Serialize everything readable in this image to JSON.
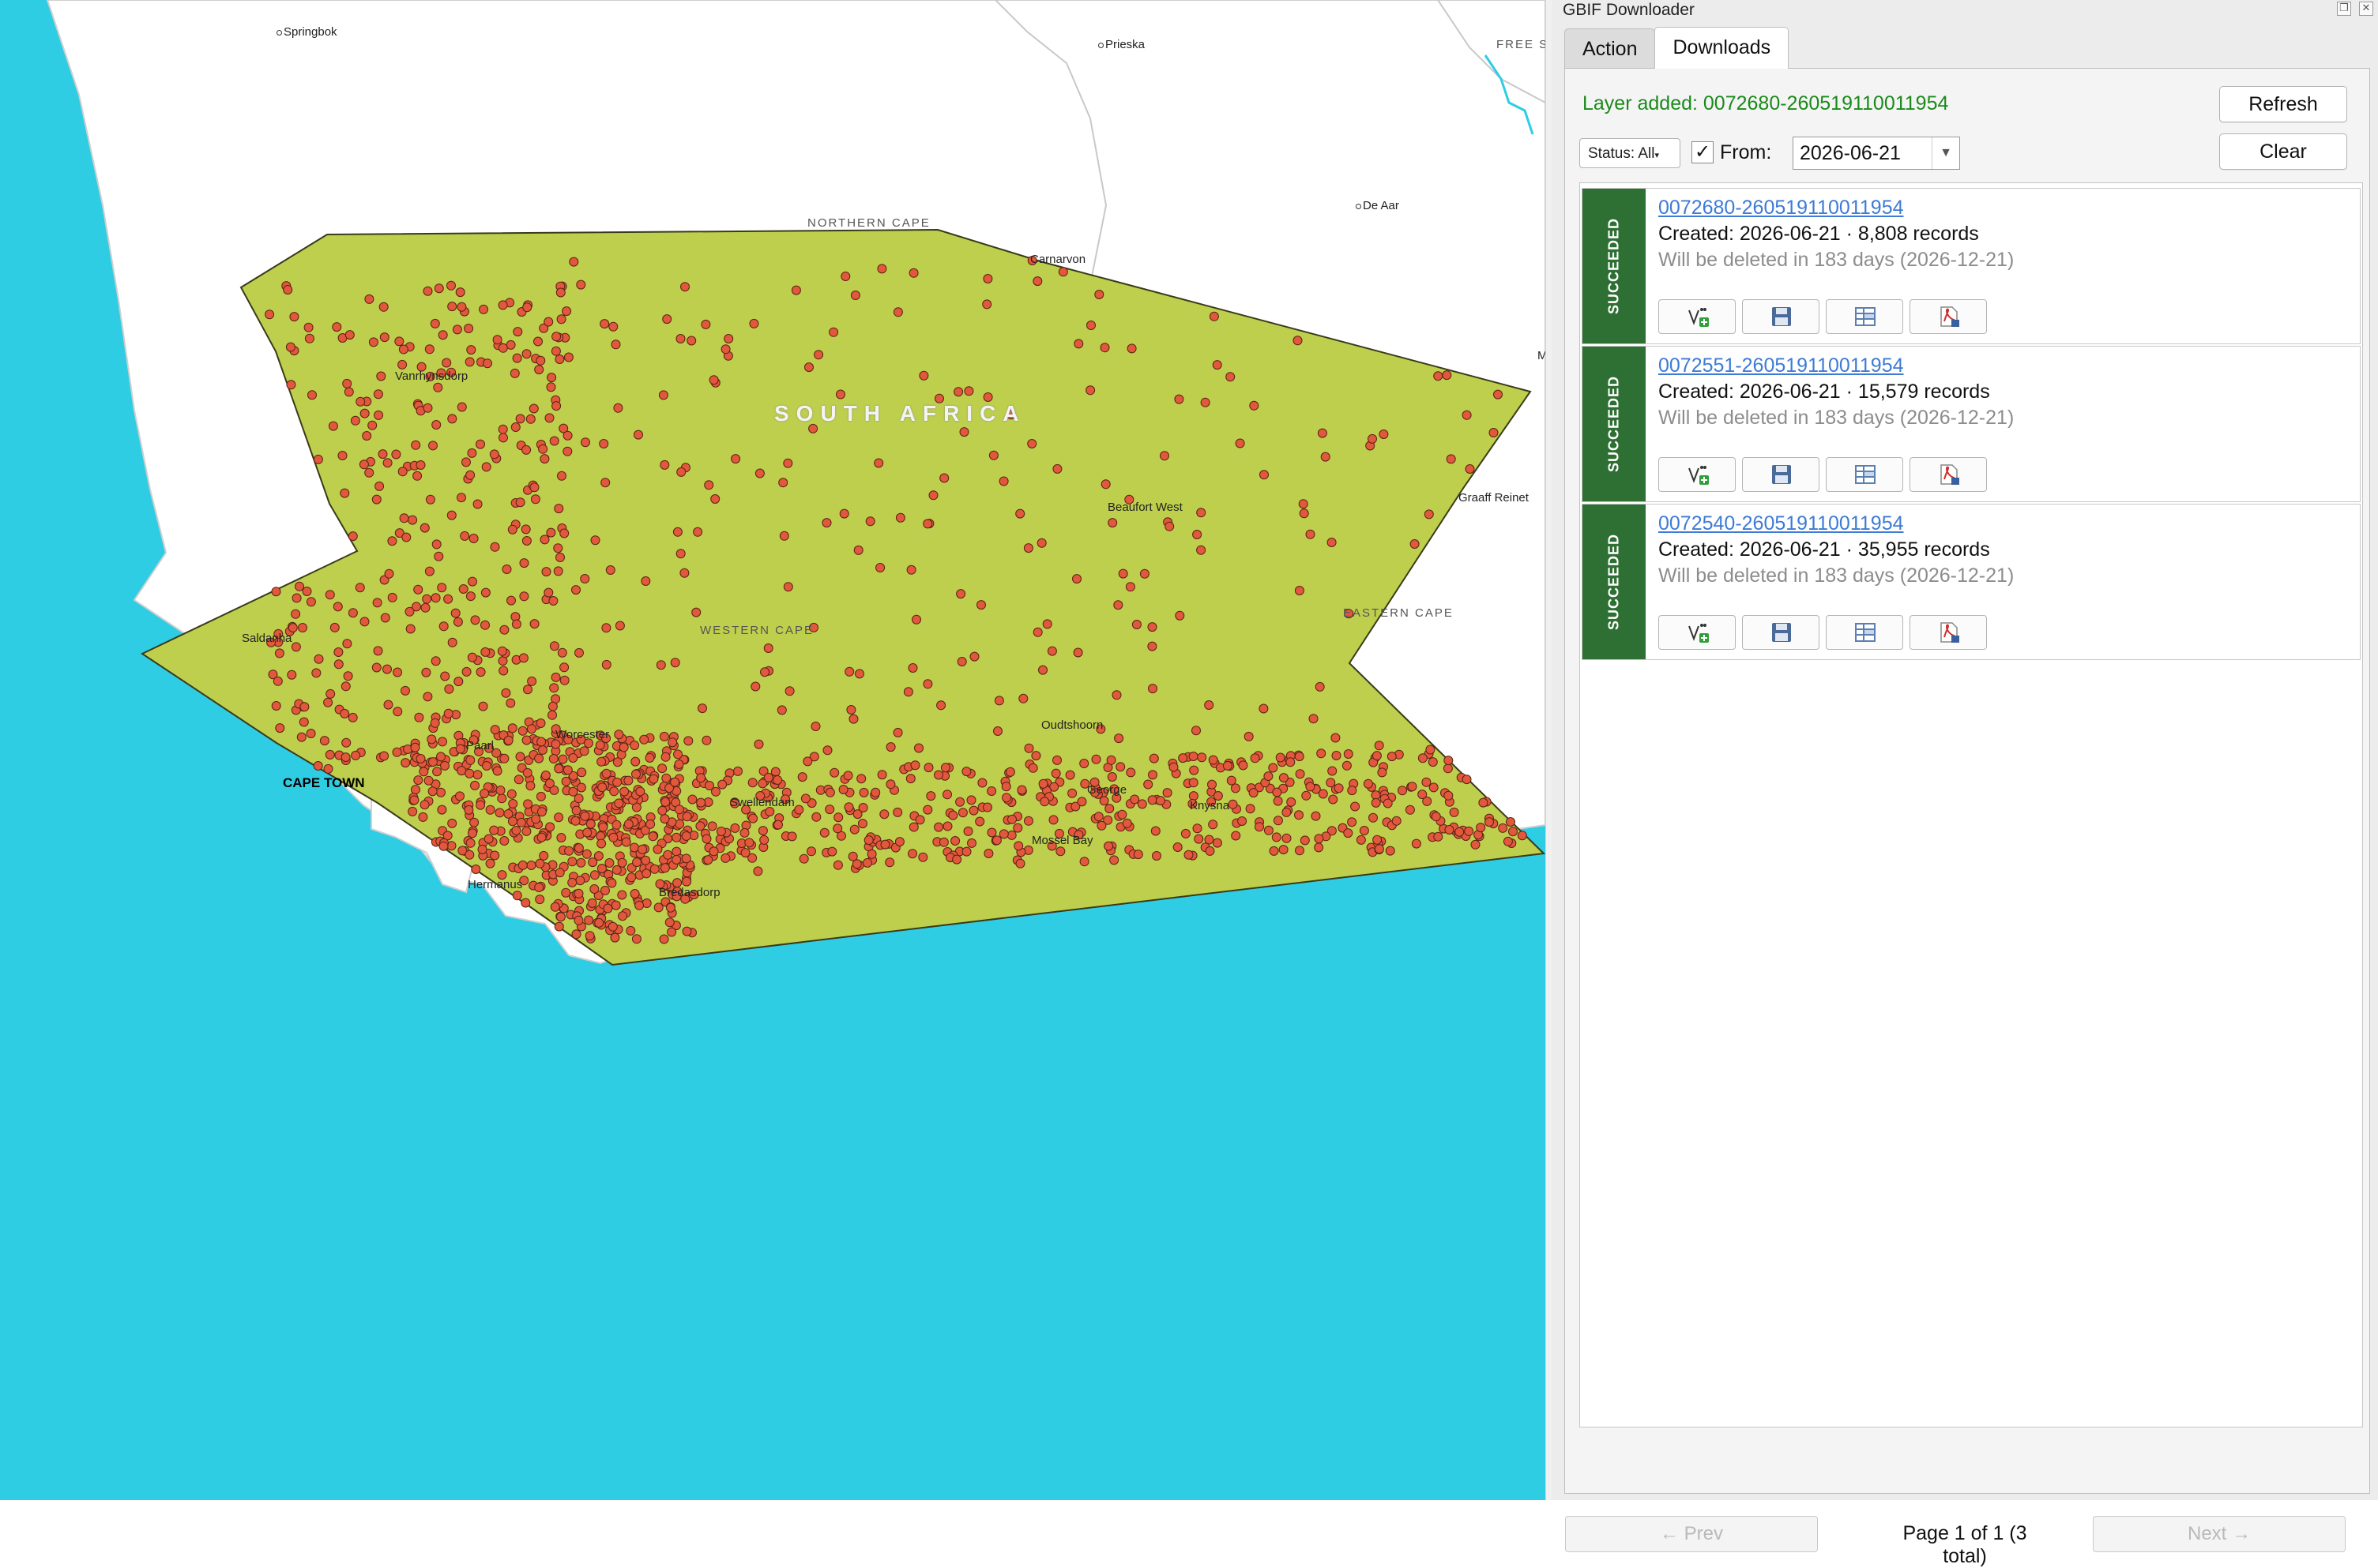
{
  "map": {
    "country_label": "SOUTH AFRICA",
    "province_labels": [
      "NORTHERN CAPE",
      "WESTERN CAPE",
      "EASTERN CAPE",
      "FREE S"
    ],
    "capital": "CAPE TOWN",
    "towns": [
      "Springbok",
      "Prieska",
      "De Aar",
      "Carnarvon",
      "Vanrhynsdorp",
      "Beaufort West",
      "Graaff Reinet",
      "Saldanha",
      "Worcester",
      "Paarl",
      "Oudtshoorn",
      "George",
      "Knysna",
      "Mossel Bay",
      "Swellendam",
      "Bredasdorp",
      "Hermanus",
      "M"
    ],
    "colors": {
      "ocean": "#2ecde4",
      "land": "#ffffff",
      "polygon": "#bdcf4c",
      "points": "#e2583c"
    }
  },
  "panel": {
    "title": "GBIF Downloader",
    "tabs": [
      {
        "label": "Action"
      },
      {
        "label": "Downloads"
      }
    ],
    "active_tab": "Downloads",
    "layer_added": "Layer added: 0072680-260519110011954",
    "refresh_label": "Refresh",
    "clear_label": "Clear",
    "status_filter": "Status: All",
    "from_checked": true,
    "from_label": "From:",
    "from_date": "2026-06-21",
    "downloads": [
      {
        "status": "SUCCEEDED",
        "key": "0072680-260519110011954",
        "created": "Created: 2026-06-21 · 8,808 records",
        "expiry": "Will be deleted in 183 days (2026-12-21)"
      },
      {
        "status": "SUCCEEDED",
        "key": "0072551-260519110011954",
        "created": "Created: 2026-06-21 · 15,579 records",
        "expiry": "Will be deleted in 183 days (2026-12-21)"
      },
      {
        "status": "SUCCEEDED",
        "key": "0072540-260519110011954",
        "created": "Created: 2026-06-21 · 35,955 records",
        "expiry": "Will be deleted in 183 days (2026-12-21)"
      }
    ],
    "card_actions": [
      "add-layer-icon",
      "save-icon",
      "attributes-icon",
      "pdf-icon"
    ],
    "pager": {
      "prev": "← Prev",
      "label": "Page 1 of 1  (3 total)",
      "next": "Next →"
    }
  }
}
